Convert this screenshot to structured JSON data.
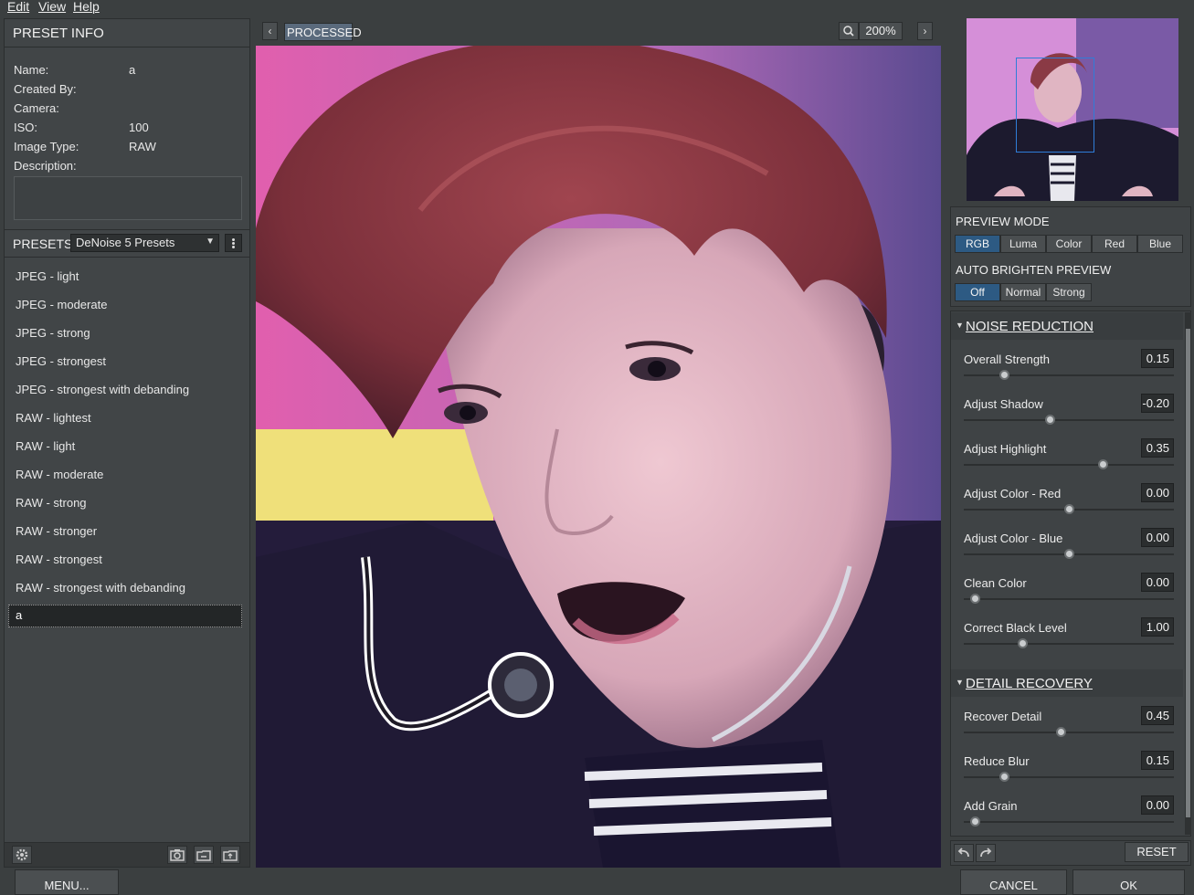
{
  "menubar": [
    "Edit",
    "View",
    "Help"
  ],
  "preset_info": {
    "title": "PRESET INFO",
    "rows": [
      {
        "label": "Name:",
        "value": "a"
      },
      {
        "label": "Created By:",
        "value": ""
      },
      {
        "label": "Camera:",
        "value": ""
      },
      {
        "label": "ISO:",
        "value": "100"
      },
      {
        "label": "Image Type:",
        "value": "RAW"
      },
      {
        "label": "Description:",
        "value": ""
      }
    ]
  },
  "presets": {
    "title": "PRESETS",
    "selected_set": "DeNoise 5 Presets",
    "items": [
      "JPEG - light",
      "JPEG - moderate",
      "JPEG - strong",
      "JPEG - strongest",
      "JPEG - strongest with debanding",
      "RAW - lightest",
      "RAW - light",
      "RAW - moderate",
      "RAW - strong",
      "RAW - stronger",
      "RAW - strongest",
      "RAW - strongest with debanding"
    ],
    "new_preset_value": "a"
  },
  "viewer": {
    "mode_label": "PROCESSED",
    "zoom": "200%",
    "prev_arrow": "‹",
    "next_arrow": "›"
  },
  "preview_mode": {
    "title": "PREVIEW MODE",
    "options": [
      "RGB",
      "Luma",
      "Color",
      "Red",
      "Blue"
    ],
    "selected": "RGB"
  },
  "auto_brighten": {
    "title": "AUTO BRIGHTEN PREVIEW",
    "options": [
      "Off",
      "Normal",
      "Strong"
    ],
    "selected": "Off"
  },
  "noise_reduction": {
    "title": "NOISE REDUCTION",
    "sliders": [
      {
        "label": "Overall Strength",
        "value": "0.15",
        "position": 0.19
      },
      {
        "label": "Adjust Shadow",
        "value": "-0.20",
        "position": 0.41
      },
      {
        "label": "Adjust Highlight",
        "value": "0.35",
        "position": 0.66
      },
      {
        "label": "Adjust Color - Red",
        "value": "0.00",
        "position": 0.5
      },
      {
        "label": "Adjust Color - Blue",
        "value": "0.00",
        "position": 0.5
      },
      {
        "label": "Clean Color",
        "value": "0.00",
        "position": 0.05
      },
      {
        "label": "Correct Black Level",
        "value": "1.00",
        "position": 0.28
      }
    ]
  },
  "detail_recovery": {
    "title": "DETAIL RECOVERY",
    "sliders": [
      {
        "label": "Recover Detail",
        "value": "0.45",
        "position": 0.46
      },
      {
        "label": "Reduce Blur",
        "value": "0.15",
        "position": 0.19
      },
      {
        "label": "Add Grain",
        "value": "0.00",
        "position": 0.05
      }
    ]
  },
  "buttons": {
    "reset": "RESET",
    "menu": "MENU...",
    "cancel": "CANCEL",
    "ok": "OK"
  },
  "colors": {
    "accent_active": "#2d5a83",
    "panel_bg": "#414547",
    "window_bg": "#3b3f40"
  }
}
